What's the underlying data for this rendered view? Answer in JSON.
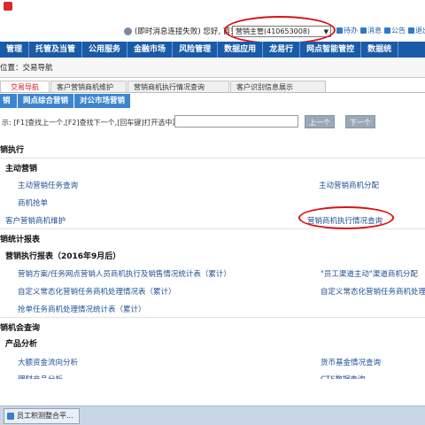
{
  "header": {
    "user_line": "(即时消息连接失败)  您好, 苗秀青",
    "role_selected": "营销主管(410653008)",
    "links": [
      "待办",
      "消息",
      "公告",
      "退出"
    ]
  },
  "nav": {
    "items": [
      "管理",
      "托管及当管",
      "公用服务",
      "金融市场",
      "风险管理",
      "数据应用",
      "龙易行",
      "网点智能管控",
      "数据统"
    ]
  },
  "breadcrumb": "位置：交易导航",
  "tabs": [
    {
      "label": "交易导航"
    },
    {
      "label": "客户营销商机维护"
    },
    {
      "label": "营销商机执行情况查询"
    },
    {
      "label": "客户识别信息展示"
    }
  ],
  "subtabs": [
    "销",
    "网点综合营销",
    "对公市场营销"
  ],
  "search": {
    "hint": "示: [F1]查找上一个,[F2]查找下一个,[回车键]打开选中菜单.",
    "prev_label": "上一个",
    "next_label": "下一个"
  },
  "content": {
    "sec_exec": "销执行",
    "sec_active": "主动营销",
    "link_task_query": "主动营销任务查询",
    "link_opp_assign": "主动营销商机分配",
    "link_opp_grab": "商机抢单",
    "link_cust_maint": "客户营销商机维护",
    "link_exec_query": "营销商机执行情况查询",
    "sec_stats": "销统计报表",
    "sec_exec_report": "营销执行报表（2016年9月后）",
    "link_plan_stats": "营销方案/任务网点营销人员商机执行及销售情况统计表（累计）",
    "link_staff_channel": "\"员工渠道主动\"渠道商机分配",
    "link_custom_proc": "自定义常态化营销任务商机处理情况表（累计）",
    "link_custom_proc2": "自定义常态化营销任务商机处理",
    "link_grab_stats": "抢单任务商机处理情况统计表（累计）",
    "sec_opp_query": "销机会查询",
    "sec_product": "产品分析",
    "link_large_funds": "大额资金流向分析",
    "link_money_fund": "货币基金情况查询",
    "link_cut1": "理财产品分析",
    "link_cut2": "CTS数据查询"
  },
  "taskbar": {
    "item": "员工积测整合平..."
  }
}
